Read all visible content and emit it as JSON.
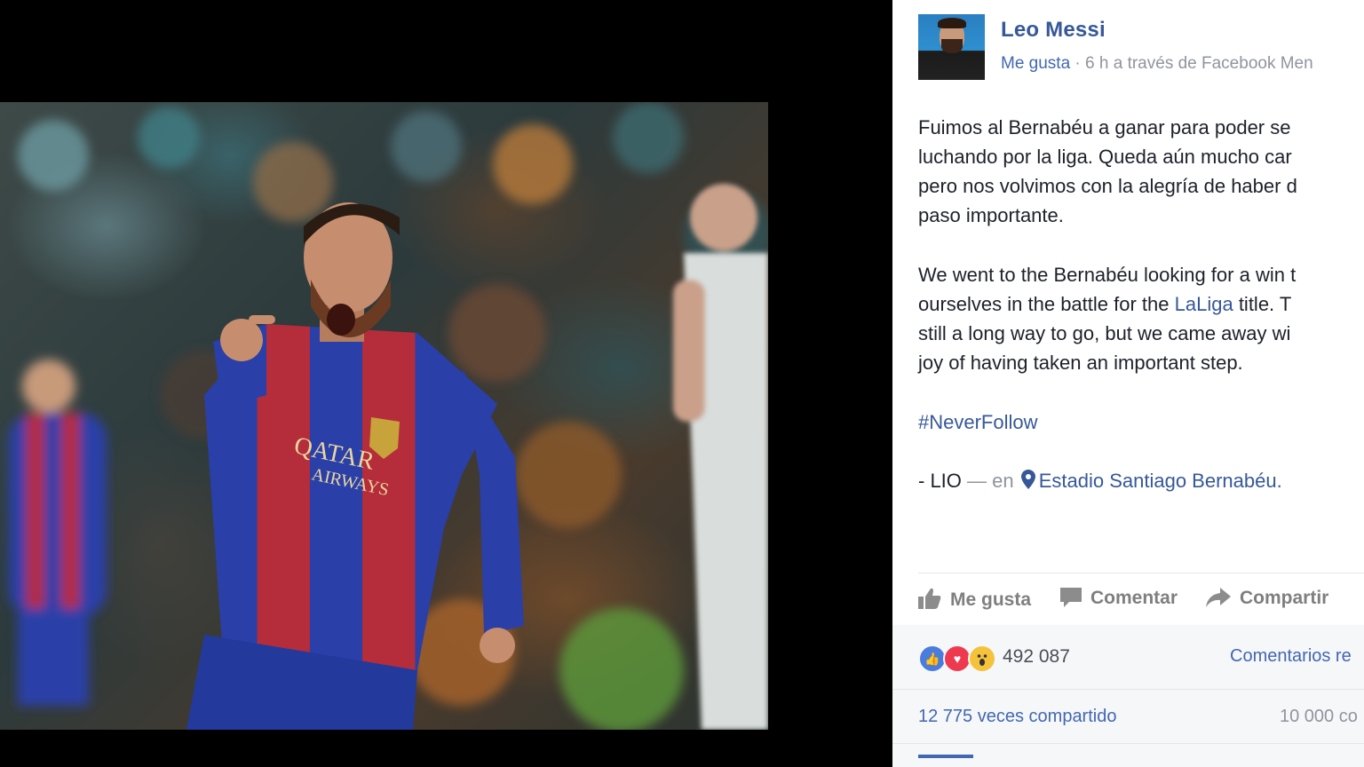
{
  "post": {
    "author": "Leo Messi",
    "like_link": "Me gusta",
    "meta_rest": " · 6 h a través de Facebook Men",
    "paragraph_es": [
      "Fuimos al Bernabéu a ganar para poder se",
      "luchando por la liga. Queda aún mucho car",
      "pero nos volvimos con la alegría de haber d",
      "paso importante."
    ],
    "paragraph_en": {
      "line1": "We went to the Bernabéu looking for a win t",
      "line2_pre": "ourselves in the battle for the ",
      "line2_link": "LaLiga",
      "line2_post": " title. T",
      "line3": "still a long way to go, but we came away wi",
      "line4": "joy of having taken an important step."
    },
    "hashtag": "#NeverFollow",
    "signature": "- LIO",
    "location_connector": " — en ",
    "location": "Estadio Santiago Bernabéu."
  },
  "actions": {
    "like": "Me gusta",
    "comment": "Comentar",
    "share": "Compartir"
  },
  "stats": {
    "reaction_icons": [
      "like-icon",
      "love-icon",
      "wow-icon"
    ],
    "reaction_count": "492 087",
    "comments_order": "Comentarios re",
    "shares": "12 775 veces compartido",
    "comments_count": "10 000 co"
  },
  "colors": {
    "link": "#365899",
    "like_blue": "#4267b2",
    "love_red": "#ee3a4f",
    "wow_yellow": "#f5c33b"
  }
}
